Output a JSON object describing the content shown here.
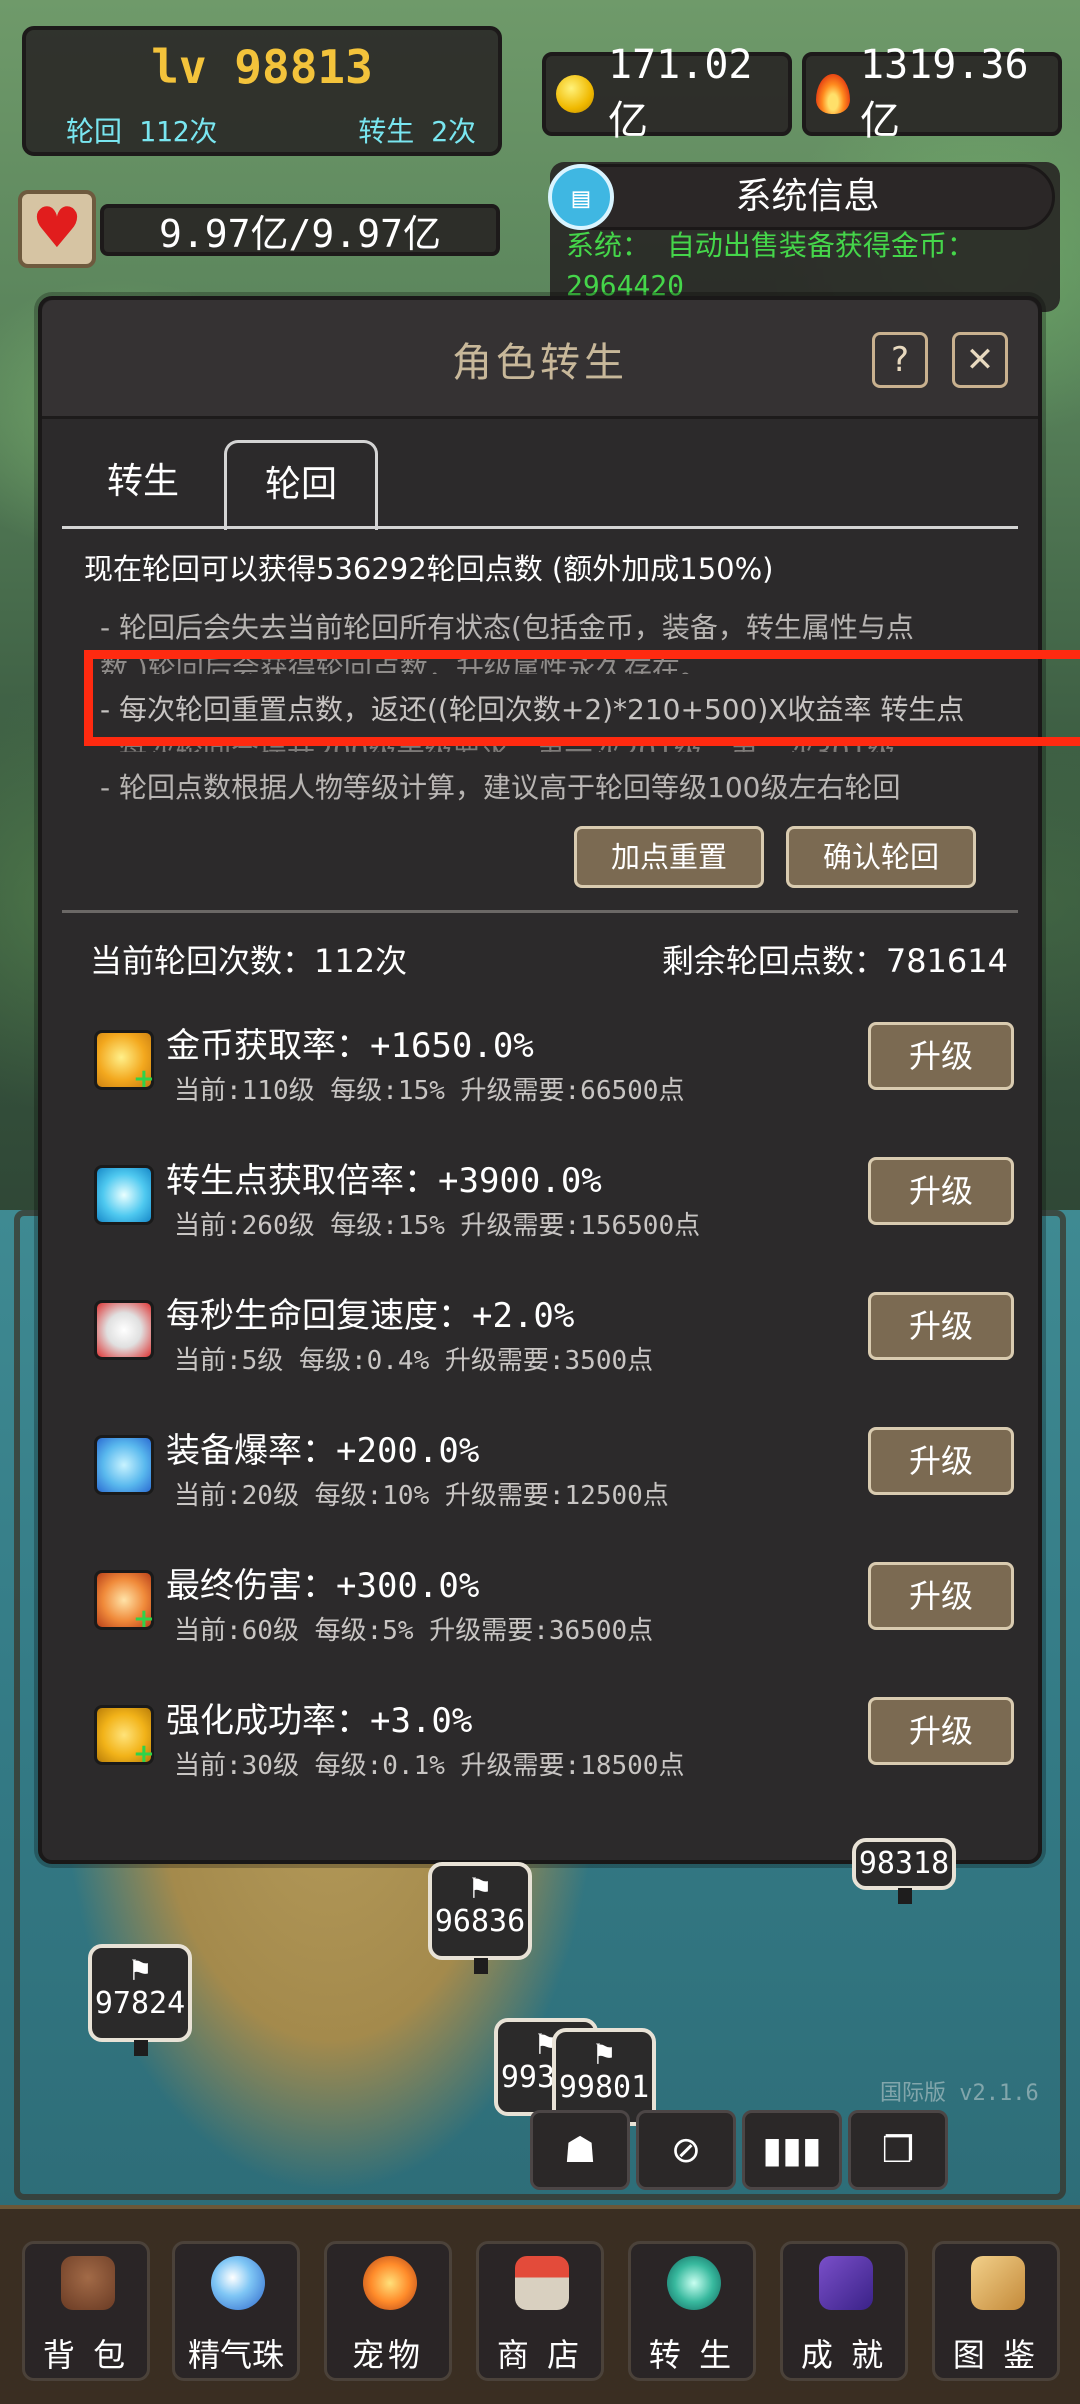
{
  "hud": {
    "level": "lv 98813",
    "cycles": "轮回 112次",
    "rebirths": "转生 2次",
    "gold": "171.02亿",
    "power": "1319.36亿",
    "hp": "9.97亿/9.97亿"
  },
  "system": {
    "title": "系统信息",
    "message": "系统： 自动出售装备获得金币：2964420"
  },
  "dialog": {
    "title": "角色转生",
    "help": "?",
    "close": "✕",
    "tabs": [
      "转生",
      "轮回"
    ],
    "summary": "现在轮回可以获得536292轮回点数 (额外加成150%)",
    "rules": [
      "- 轮回后会失去当前轮回所有状态(包括金币，装备，转生属性与点",
      "数,)轮回后会获得轮回点数，升级属性永久存在。",
      "- 每次轮回重置点数，返还((轮回次数+2)*210+500)X收益率 转生点",
      "- 每次轮回会提升200级等级要求，第一次201级，第二次301级",
      "- 轮回点数根据人物等级计算，建议高于轮回等级100级左右轮回"
    ],
    "reset_button": "加点重置",
    "confirm_button": "确认轮回",
    "current_count": "当前轮回次数：112次",
    "remaining_points": "剩余轮回点数：781614",
    "upgrade_label": "升级",
    "upgrades": [
      {
        "name": "金币获取率：+1650.0%",
        "detail": "当前:110级   每级:15%   升级需要:66500点"
      },
      {
        "name": "转生点获取倍率：+3900.0%",
        "detail": "当前:260级   每级:15%   升级需要:156500点"
      },
      {
        "name": "每秒生命回复速度：+2.0%",
        "detail": "当前:5级   每级:0.4%   升级需要:3500点"
      },
      {
        "name": "装备爆率：+200.0%",
        "detail": "当前:20级   每级:10%   升级需要:12500点"
      },
      {
        "name": "最终伤害：+300.0%",
        "detail": "当前:60级   每级:5%   升级需要:36500点"
      },
      {
        "name": "强化成功率：+3.0%",
        "detail": "当前:30级   每级:0.1%   升级需要:18500点"
      }
    ]
  },
  "map": {
    "markers": [
      "96836",
      "97824",
      "99307",
      "99801",
      "98318"
    ],
    "version": "国际版 v2.1.6"
  },
  "nav": [
    "背 包",
    "精气珠",
    "宠物",
    "商 店",
    "转 生",
    "成 就",
    "图 鉴"
  ],
  "colors": {
    "highlight": "#ff2a10",
    "level": "#f3c33b",
    "accent_cyan": "#79e6f0",
    "button": "#7b6a52"
  }
}
